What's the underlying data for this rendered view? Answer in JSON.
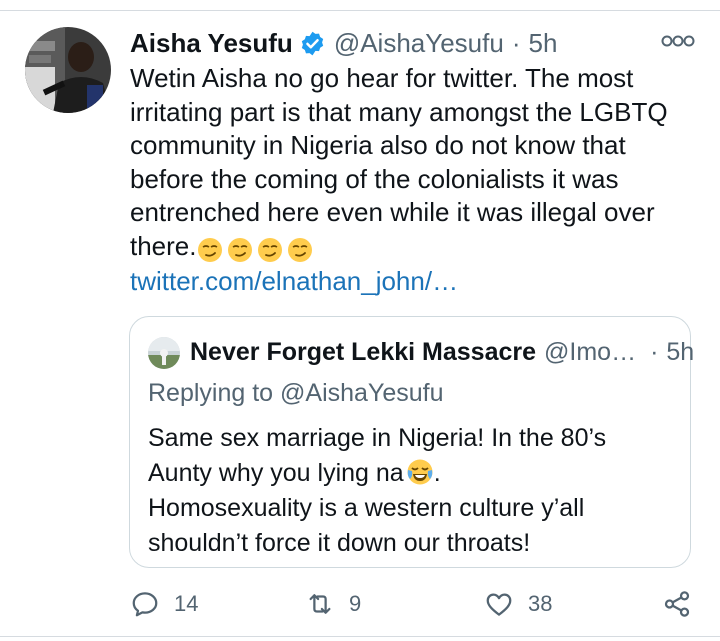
{
  "tweet": {
    "author_name": "Aisha Yesufu",
    "author_handle": "@AishaYesufu",
    "separator": "·",
    "time": "5h",
    "text": "Wetin Aisha no go hear for twitter. The most irritating part is that many amongst the LGBTQ community in Nigeria also do not know that before the coming of the colonialists it was entrenched here even while it was illegal over there.",
    "emojis": [
      "smirking-face",
      "smirking-face",
      "smirking-face",
      "smirking-face"
    ],
    "link": "twitter.com/elnathan_john/…"
  },
  "quoted": {
    "author_name": "Never Forget Lekki Massacre",
    "author_handle": "@Imo…",
    "separator": "·",
    "time": "5h",
    "replying_to": "Replying to @AishaYesufu",
    "line1": "Same sex marriage in Nigeria! In the 80’s",
    "line2": "Aunty why you lying na",
    "emoji": "face-with-tears-of-joy",
    "line3": "Homosexuality is a western culture y’all",
    "line4": "shouldn’t force it down our throats!"
  },
  "actions": {
    "replies": "14",
    "retweets": "9",
    "likes": "38"
  },
  "colors": {
    "text": "#0f1419",
    "secondary": "#536471",
    "link": "#1b73b8",
    "verified": "#1d9bf0",
    "border": "#cfd9de"
  }
}
